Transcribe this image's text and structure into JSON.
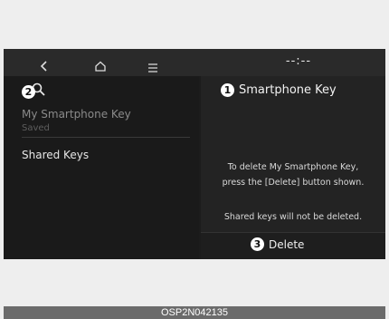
{
  "topbar": {
    "back_icon": "chevron-left-icon",
    "home_icon": "home-icon",
    "menu_icon": "menu-icon",
    "clock": "--:--"
  },
  "left_panel": {
    "search_icon": "search-icon",
    "callout": "2",
    "items": [
      {
        "label": "My Smartphone Key",
        "sublabel": "Saved"
      },
      {
        "label": "Shared Keys"
      }
    ]
  },
  "right_panel": {
    "callout": "1",
    "title": "Smartphone Key",
    "info_lines": [
      "To delete My Smartphone Key,",
      "press the [Delete] button shown.",
      "Shared keys will not be deleted."
    ],
    "delete": {
      "callout": "3",
      "label": "Delete"
    }
  },
  "caption": "OSP2N042135",
  "colors": {
    "screen_bg": "#1c1c1c",
    "topbar_bg": "#2a2a2a",
    "caption_bg": "#6b6b6b",
    "page_bg": "#eeeeee"
  }
}
